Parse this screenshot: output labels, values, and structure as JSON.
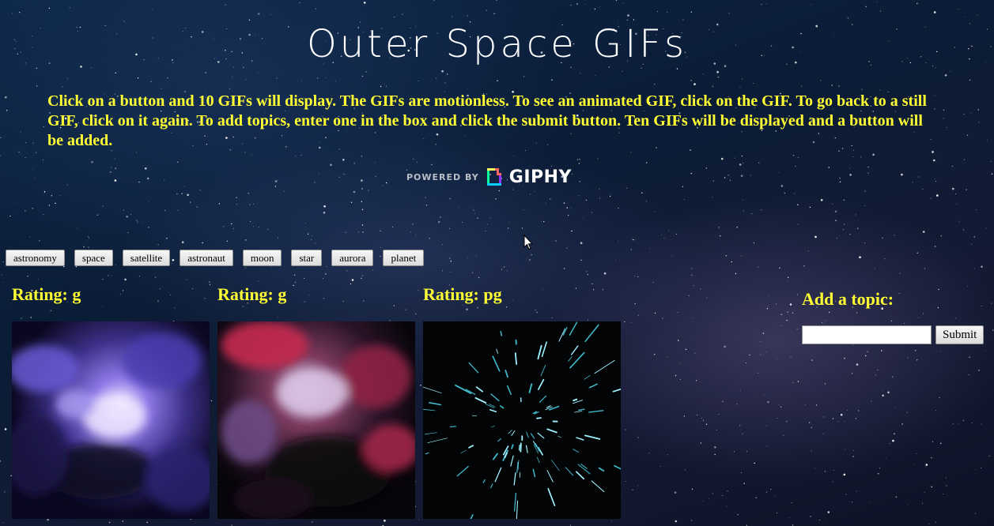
{
  "page": {
    "title": "Outer Space GIFs",
    "instructions": "Click on a button and 10 GIFs will display. The GIFs are motionless. To see an animated GIF, click on the GIF. To go back to a still GIF, click on it again. To add topics, enter one in the box and click the submit button. Ten GIFs will be displayed and a button will be added."
  },
  "attribution": {
    "powered_by": "POWERED BY",
    "brand": "GIPHY"
  },
  "topics": [
    "astronomy",
    "space",
    "satellite",
    "astronaut",
    "moon",
    "star",
    "aurora",
    "planet"
  ],
  "gifs": [
    {
      "rating": "Rating: g",
      "theme": "violet nebula"
    },
    {
      "rating": "Rating: g",
      "theme": "red nebula"
    },
    {
      "rating": "Rating: pg",
      "theme": "warp star streaks"
    }
  ],
  "add_topic": {
    "label": "Add a topic:",
    "input_value": "",
    "submit_label": "Submit"
  },
  "colors": {
    "accent_text": "#ffff33",
    "title_text": "#ffffff"
  }
}
